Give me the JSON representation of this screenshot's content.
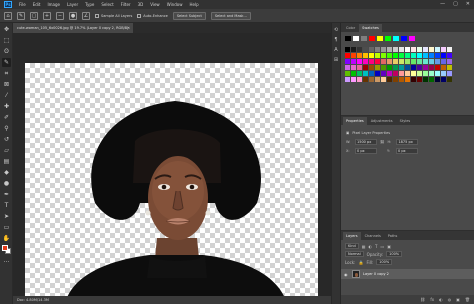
{
  "app": {
    "logo_text": "Ps",
    "menu": [
      "File",
      "Edit",
      "Image",
      "Layer",
      "Type",
      "Select",
      "Filter",
      "3D",
      "View",
      "Window",
      "Help"
    ],
    "window_controls": [
      "—",
      "▢",
      "✕"
    ]
  },
  "options_bar": {
    "sample_all_layers": "Sample All Layers",
    "auto_enhance": "Auto-Enhance",
    "select_subject": "Select Subject",
    "select_and_mask": "Select and Mask..."
  },
  "document": {
    "tab_title": "cute-woman_105_6x0026.jpg @ 19.7% (Layer 0 copy 2, RGB/8)",
    "tab_close": "✕",
    "status": "Doc: 4.80M/14.3M"
  },
  "tools": [
    {
      "name": "move-tool-icon",
      "glyph": "✥"
    },
    {
      "name": "marquee-tool-icon",
      "glyph": "⬚"
    },
    {
      "name": "lasso-tool-icon",
      "glyph": "ʘ"
    },
    {
      "name": "quick-selection-tool-icon",
      "glyph": "✎"
    },
    {
      "name": "crop-tool-icon",
      "glyph": "⌗"
    },
    {
      "name": "frame-tool-icon",
      "glyph": "⊠"
    },
    {
      "name": "eyedropper-tool-icon",
      "glyph": "⁄"
    },
    {
      "name": "healing-brush-tool-icon",
      "glyph": "✚"
    },
    {
      "name": "brush-tool-icon",
      "glyph": "✐"
    },
    {
      "name": "clone-stamp-tool-icon",
      "glyph": "⚲"
    },
    {
      "name": "history-brush-tool-icon",
      "glyph": "↺"
    },
    {
      "name": "eraser-tool-icon",
      "glyph": "▱"
    },
    {
      "name": "gradient-tool-icon",
      "glyph": "▤"
    },
    {
      "name": "blur-tool-icon",
      "glyph": "◆"
    },
    {
      "name": "dodge-tool-icon",
      "glyph": "●"
    },
    {
      "name": "pen-tool-icon",
      "glyph": "✒"
    },
    {
      "name": "type-tool-icon",
      "glyph": "T"
    },
    {
      "name": "path-selection-tool-icon",
      "glyph": "➤"
    },
    {
      "name": "rectangle-tool-icon",
      "glyph": "▭"
    },
    {
      "name": "hand-tool-icon",
      "glyph": "✋"
    },
    {
      "name": "zoom-tool-icon",
      "glyph": "⚲"
    },
    {
      "name": "more-tools-icon",
      "glyph": "…"
    }
  ],
  "colors": {
    "foreground": "#e33b19",
    "background": "#ffffff"
  },
  "panels": {
    "top_tabs": [
      "Color",
      "Swatches"
    ],
    "props_tabs": [
      "Properties",
      "Adjustments",
      "Styles"
    ],
    "props_title": "Pixel Layer Properties",
    "props": {
      "w_label": "W:",
      "w_value": "1500 px",
      "h_label": "H:",
      "h_value": "1875 px",
      "x_label": "X:",
      "x_value": "0 px",
      "y_label": "Y:",
      "y_value": "0 px"
    },
    "layers_tabs": [
      "Layers",
      "Channels",
      "Paths"
    ],
    "layers": {
      "kind": "Kind",
      "blend_mode": "Normal",
      "opacity_label": "Opacity:",
      "opacity_value": "100%",
      "lock_label": "Lock:",
      "fill_label": "Fill:",
      "fill_value": "100%",
      "items": [
        {
          "name": "Layer 0 copy 2",
          "visible": true
        }
      ],
      "footer_icons": [
        "⛓",
        "fx",
        "◐",
        "◍",
        "▣",
        "🗑"
      ]
    }
  },
  "swatch_top_colors": [
    "#000000",
    "#ffffff",
    "#7f7f7f",
    "#ff0000",
    "#ffff00",
    "#00ff00",
    "#00ffff",
    "#0000ff",
    "#ff00ff"
  ],
  "swatch_grid_colors": [
    "#000000",
    "#1a1a1a",
    "#333333",
    "#4d4d4d",
    "#666666",
    "#808080",
    "#999999",
    "#b3b3b3",
    "#cccccc",
    "#e6e6e6",
    "#ffffff",
    "#ffe6e6",
    "#e6ffe6",
    "#e6e6ff",
    "#fff5cc",
    "#ccf5ff",
    "#f5ccff",
    "#f0f0f0",
    "#ff0000",
    "#ff4000",
    "#ff8000",
    "#ffbf00",
    "#ffff00",
    "#bfff00",
    "#80ff00",
    "#40ff00",
    "#00ff00",
    "#00ff40",
    "#00ff80",
    "#00ffbf",
    "#00ffff",
    "#00bfff",
    "#0080ff",
    "#0040ff",
    "#0000ff",
    "#4000ff",
    "#8000ff",
    "#bf00ff",
    "#ff00ff",
    "#ff00bf",
    "#ff0080",
    "#ff0040",
    "#e06666",
    "#e69966",
    "#e6cc66",
    "#cce666",
    "#99e666",
    "#66e666",
    "#66e699",
    "#66e6cc",
    "#66cce6",
    "#6699e6",
    "#6666e6",
    "#9966e6",
    "#cc66e6",
    "#e666cc",
    "#e66699",
    "#990000",
    "#994d00",
    "#999900",
    "#4d9900",
    "#009900",
    "#00994d",
    "#009999",
    "#004d99",
    "#000099",
    "#4d0099",
    "#990099",
    "#99004d",
    "#c00000",
    "#c06000",
    "#c0c000",
    "#60c000",
    "#00c000",
    "#00c060",
    "#00c0c0",
    "#0060c0",
    "#0000c0",
    "#6000c0",
    "#c000c0",
    "#c00060",
    "#ff9999",
    "#ffcc99",
    "#ffff99",
    "#ccff99",
    "#99ff99",
    "#99ffcc",
    "#99ffff",
    "#99ccff",
    "#9999ff",
    "#cc99ff",
    "#ff99ff",
    "#ff99cc",
    "#663300",
    "#996633",
    "#cc9966",
    "#ffcc99",
    "#4d2600",
    "#804000",
    "#b35900",
    "#e67300",
    "#330000",
    "#660000",
    "#003300",
    "#006600",
    "#000033",
    "#000066",
    "#333300"
  ]
}
